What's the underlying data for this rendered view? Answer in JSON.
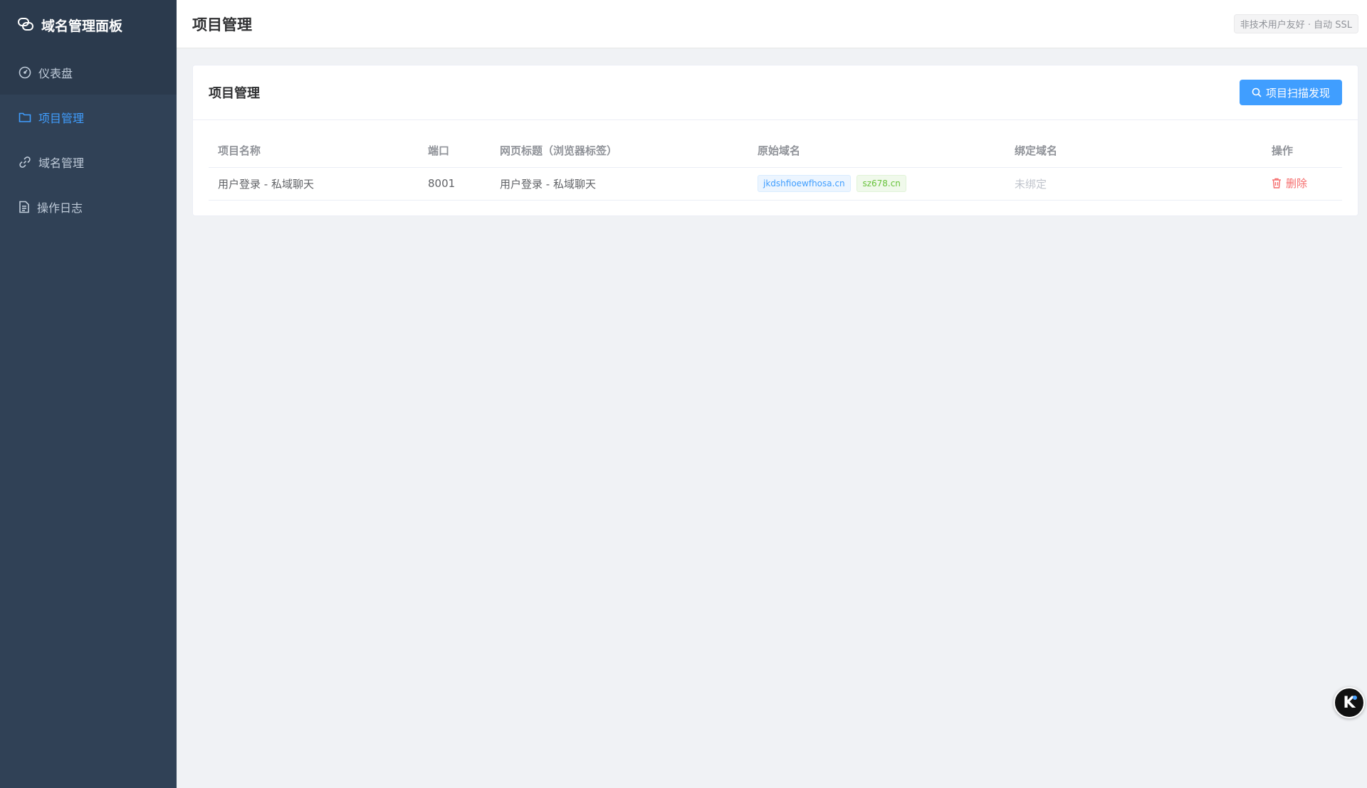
{
  "sidebar": {
    "brand": "域名管理面板",
    "items": [
      {
        "label": "仪表盘",
        "icon": "dashboard-icon"
      },
      {
        "label": "项目管理",
        "icon": "folder-icon",
        "active": true
      },
      {
        "label": "域名管理",
        "icon": "link-icon"
      },
      {
        "label": "操作日志",
        "icon": "document-icon"
      }
    ]
  },
  "header": {
    "title": "项目管理",
    "badge": "非技术用户友好 · 自动 SSL"
  },
  "card": {
    "title": "项目管理",
    "scan_button": "项目扫描发现"
  },
  "table": {
    "columns": [
      "项目名称",
      "端口",
      "网页标题（浏览器标签）",
      "原始域名",
      "绑定域名",
      "操作"
    ],
    "rows": [
      {
        "name": "用户登录 - 私域聊天",
        "port": "8001",
        "page_title": "用户登录 - 私域聊天",
        "original_domains": [
          "jkdshfioewfhosa.cn",
          "sz678.cn"
        ],
        "bound_domain": "未绑定",
        "action": "删除"
      }
    ]
  },
  "colors": {
    "sidebar_bg": "#304156",
    "accent": "#409eff",
    "danger": "#f56c6c",
    "success": "#67c23a"
  }
}
